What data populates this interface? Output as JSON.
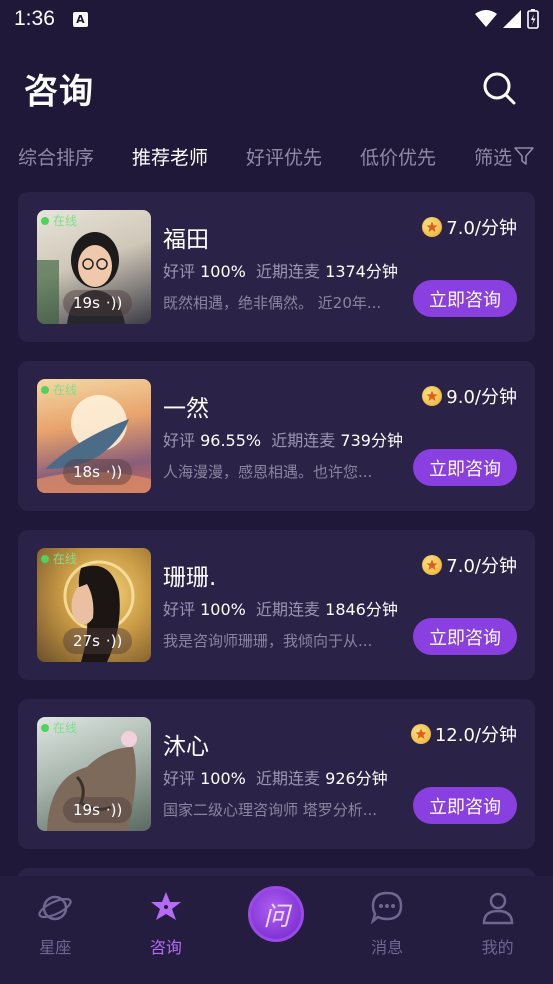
{
  "status_bar": {
    "time": "1:36"
  },
  "header": {
    "title": "咨询"
  },
  "tabs": [
    {
      "label": "综合排序",
      "active": false
    },
    {
      "label": "推荐老师",
      "active": true
    },
    {
      "label": "好评优先",
      "active": false
    },
    {
      "label": "低价优先",
      "active": false
    },
    {
      "label": "筛选",
      "active": false
    }
  ],
  "cards": [
    {
      "name": "福田",
      "online": "在线",
      "voice": "19s",
      "price": "7.0/分钟",
      "rating_label": "好评",
      "rating": "100%",
      "recent_label": "近期连麦",
      "recent": "1374分钟",
      "desc": "既然相遇，绝非偶然。 近20年...",
      "button": "立即咨询"
    },
    {
      "name": "一然",
      "online": "在线",
      "voice": "18s",
      "price": "9.0/分钟",
      "rating_label": "好评",
      "rating": "96.55%",
      "recent_label": "近期连麦",
      "recent": "739分钟",
      "desc": "人海漫漫，感恩相遇。也许您...",
      "button": "立即咨询"
    },
    {
      "name": "珊珊.",
      "online": "在线",
      "voice": "27s",
      "price": "7.0/分钟",
      "rating_label": "好评",
      "rating": "100%",
      "recent_label": "近期连麦",
      "recent": "1846分钟",
      "desc": "我是咨询师珊珊，我倾向于从...",
      "button": "立即咨询"
    },
    {
      "name": "沐心",
      "online": "在线",
      "voice": "19s",
      "price": "12.0/分钟",
      "rating_label": "好评",
      "rating": "100%",
      "recent_label": "近期连麦",
      "recent": "926分钟",
      "desc": "国家二级心理咨询师 塔罗分析...",
      "button": "立即咨询"
    }
  ],
  "bottom_nav": {
    "items": [
      {
        "label": "星座",
        "icon": "planet-icon",
        "active": false
      },
      {
        "label": "咨询",
        "icon": "star-icon",
        "active": true
      },
      {
        "label": "问",
        "icon": "ask-icon",
        "active": false
      },
      {
        "label": "消息",
        "icon": "chat-icon",
        "active": false
      },
      {
        "label": "我的",
        "icon": "user-icon",
        "active": false
      }
    ]
  },
  "colors": {
    "background": "#1f1838",
    "card": "#2b2347",
    "accent": "#8a3fe0",
    "active_nav": "#b46cf6",
    "online": "#4fd35d"
  }
}
